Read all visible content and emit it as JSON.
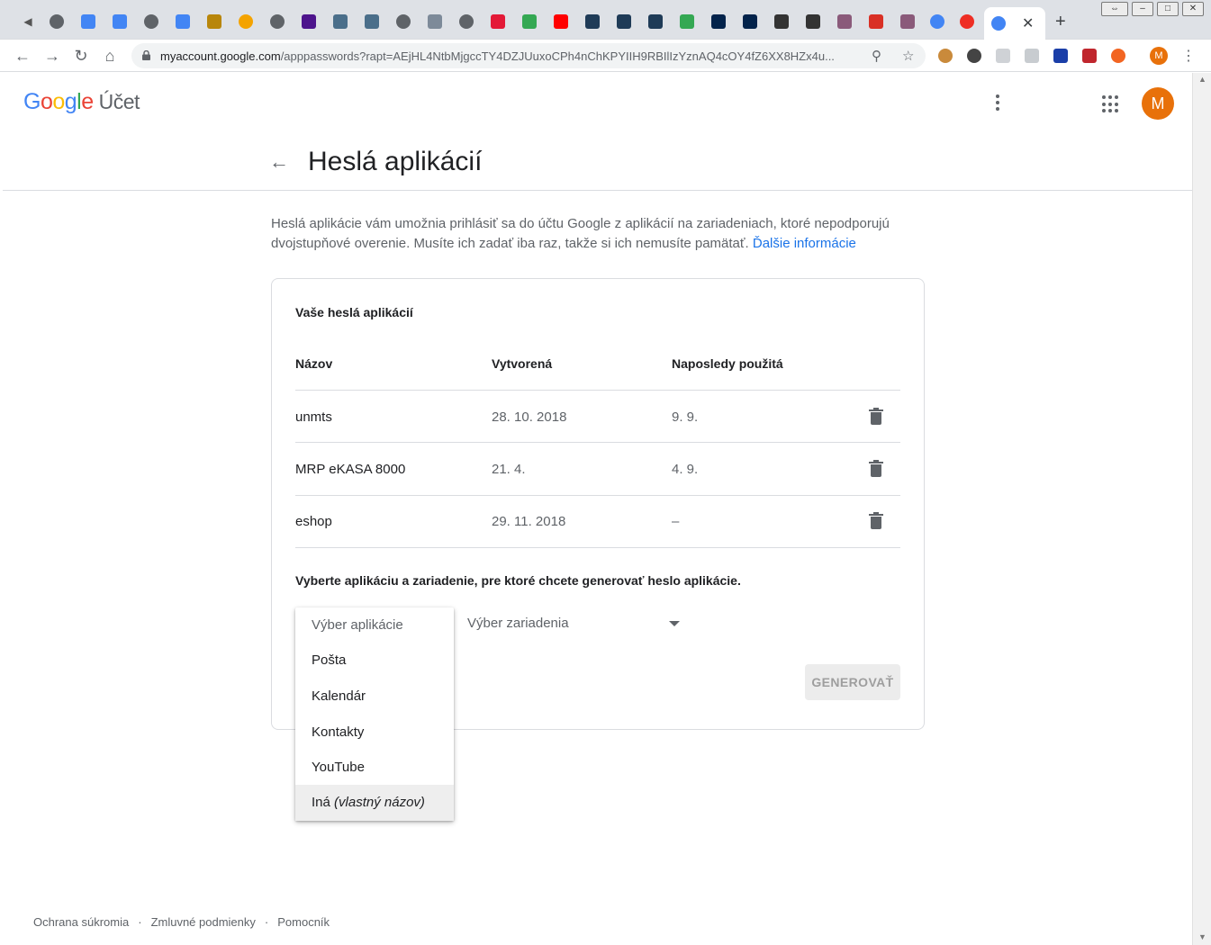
{
  "browser": {
    "active_tab_close": "✕",
    "new_tab": "+",
    "url_host": "myaccount.google.com",
    "url_path": "/apppasswords?rapt=AEjHL4NtbMjgccTY4DZJUuxoCPh4nChKPYIIH9RBIlIzYznAQ4cOY4fZ6XX8HZx4u...",
    "profile_initial": "M"
  },
  "header": {
    "logo_G": "G",
    "logo_o1": "o",
    "logo_o2": "o",
    "logo_g": "g",
    "logo_l": "l",
    "logo_e": "e",
    "product": "Účet",
    "avatar_initial": "M"
  },
  "page": {
    "title": "Heslá aplikácií",
    "intro": "Heslá aplikácie vám umožnia prihlásiť sa do účtu Google z aplikácií na zariadeniach, ktoré nepodporujú dvojstupňové overenie. Musíte ich zadať iba raz, takže si ich nemusíte pamätať. ",
    "learn_more": "Ďalšie informácie"
  },
  "card": {
    "title": "Vaše heslá aplikácií",
    "columns": [
      "Názov",
      "Vytvorená",
      "Naposledy použitá"
    ],
    "rows": [
      {
        "name": "unmts",
        "created": "28. 10. 2018",
        "last_used": "9. 9."
      },
      {
        "name": "MRP eKASA 8000",
        "created": "21. 4.",
        "last_used": "4. 9."
      },
      {
        "name": "eshop",
        "created": "29. 11. 2018",
        "last_used": "–"
      }
    ],
    "generate_prompt": "Vyberte aplikáciu a zariadenie, pre ktoré chcete generovať heslo aplikácie.",
    "device_placeholder": "Výber zariadenia",
    "generate_button": "GENEROVAŤ"
  },
  "app_dropdown": {
    "placeholder": "Výber aplikácie",
    "options": [
      "Pošta",
      "Kalendár",
      "Kontakty",
      "YouTube"
    ],
    "other_prefix": "Iná ",
    "other_italic": "(vlastný názov)"
  },
  "footer": {
    "links": [
      "Ochrana súkromia",
      "Zmluvné podmienky",
      "Pomocník"
    ],
    "separator": "·"
  },
  "colors": {
    "accent": "#1a73e8",
    "avatar": "#e8710a"
  }
}
